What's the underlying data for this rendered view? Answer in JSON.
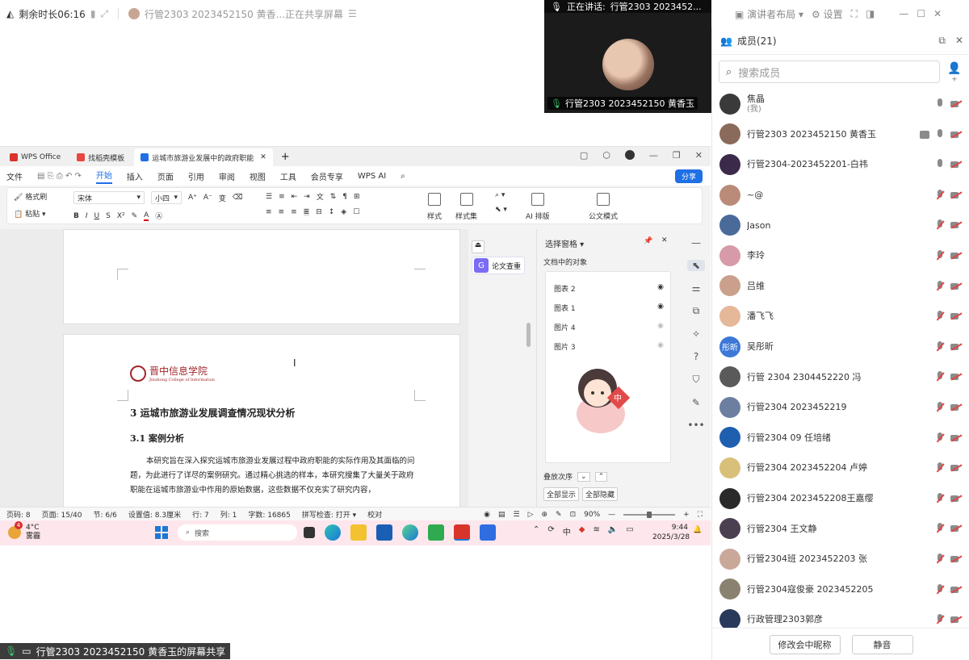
{
  "topbar": {
    "remaining_time": "剩余时长06:16",
    "sharing_status": "行管2303 2023452150 黄香...正在共享屏幕",
    "layout_label": "演讲者布局",
    "settings_label": "设置"
  },
  "speaker": {
    "speaking_label": "正在讲话:",
    "speaking_name": "行管2303 2023452...",
    "tile_name": "行管2303 2023452150 黄香玉"
  },
  "wps": {
    "tabs": [
      {
        "label": "WPS Office",
        "color": "#d9342b"
      },
      {
        "label": "找稻壳模板",
        "color": "#e8473d"
      },
      {
        "label": "运城市旅游业发展中的政府职能",
        "color": "#1f6fe5"
      }
    ],
    "menu": [
      "文件",
      "开始",
      "插入",
      "页面",
      "引用",
      "审阅",
      "视图",
      "工具",
      "会员专享",
      "WPS AI"
    ],
    "active_menu": "开始",
    "share_label": "分享",
    "ribbon": {
      "format_painter": "格式刷",
      "paste": "粘贴",
      "font": "宋体",
      "size": "小四",
      "styles": "样式",
      "style_set": "样式集",
      "ai_layout": "AI 排版",
      "official_mode": "公文模式"
    },
    "document": {
      "logo_text": "晋中信息学院",
      "logo_sub": "Jinzhong College of Information",
      "heading3": "3 运城市旅游业发展调查情况现状分析",
      "heading31": "3.1  案例分析",
      "paragraph": "本研究旨在深入探究运城市旅游业发展过程中政府职能的实际作用及其面临的问题，为此进行了详尽的案例研究。通过精心挑选的样本，本研究搜集了大量关于政府职能在运城市旅游业中作用的原始数据，这些数据不仅充实了研究内容，"
    },
    "paper_check": "论文查重",
    "selection_pane": {
      "title": "选择窗格",
      "subtitle": "文档中的对象",
      "items": [
        "图表 2",
        "图表 1",
        "图片 4",
        "图片 3"
      ],
      "order_label": "叠放次序",
      "show_all": "全部显示",
      "hide_all": "全部隐藏"
    },
    "status": {
      "page_code": "页码: 8",
      "page": "页面: 15/40",
      "section": "节: 6/6",
      "position": "设置值: 8.3厘米",
      "row": "行: 7",
      "col": "列: 1",
      "words": "字数: 16865",
      "spell": "拼写检查: 打开",
      "proof": "校对",
      "zoom": "90%",
      "zoom_level": 0.5
    }
  },
  "taskbar": {
    "temp": "4°C",
    "weather": "雾霾",
    "badge": "4",
    "search": "搜索",
    "time": "9:44",
    "date": "2025/3/28"
  },
  "share_label": "行管2303 2023452150 黄香玉的屏幕共享",
  "members": {
    "title": "成员(21)",
    "search_placeholder": "搜索成员",
    "list": [
      {
        "name": "焦晶",
        "me": "(我)",
        "mic": "on",
        "color": "#3a3a3a",
        "avatar_text": ""
      },
      {
        "name": "行管2303 2023452150 黄香玉",
        "mic": "on",
        "screen": true,
        "color": "#8a6a5a",
        "avatar_text": ""
      },
      {
        "name": "行管2304-2023452201-白祎",
        "mic": "on",
        "color": "#3b2a4a",
        "avatar_text": ""
      },
      {
        "name": "~@",
        "mic": "off",
        "color": "#b98b78",
        "avatar_text": ""
      },
      {
        "name": "Jason",
        "mic": "off",
        "color": "#4a6a9a",
        "avatar_text": ""
      },
      {
        "name": "李玲",
        "mic": "off",
        "color": "#d79aa8",
        "avatar_text": ""
      },
      {
        "name": "吕维",
        "mic": "off",
        "color": "#caa08c",
        "avatar_text": ""
      },
      {
        "name": "潘飞飞",
        "mic": "off",
        "color": "#e6b89a",
        "avatar_text": ""
      },
      {
        "name": "吴彤昕",
        "mic": "off",
        "color": "#3d78d8",
        "avatar_text": "彤昕"
      },
      {
        "name": "行管 2304 2304452220 冯",
        "mic": "off",
        "color": "#5a5a5a",
        "avatar_text": ""
      },
      {
        "name": "行管2304  2023452219",
        "mic": "off",
        "color": "#6c7fa0",
        "avatar_text": ""
      },
      {
        "name": "行管2304 09 任培绪",
        "mic": "off",
        "color": "#1e5fb0",
        "avatar_text": ""
      },
      {
        "name": "行管2304 2023452204 卢婷",
        "mic": "off",
        "color": "#d9c07a",
        "avatar_text": ""
      },
      {
        "name": "行管2304 2023452208王嘉缨",
        "mic": "off",
        "color": "#2a2a2a",
        "avatar_text": ""
      },
      {
        "name": "行管2304 王文静",
        "mic": "off",
        "color": "#4a4050",
        "avatar_text": ""
      },
      {
        "name": "行管2304班 2023452203 张",
        "mic": "off",
        "color": "#c9a89a",
        "avatar_text": ""
      },
      {
        "name": "行管2304寇俊豪 2023452205",
        "mic": "off",
        "color": "#8a8270",
        "avatar_text": ""
      },
      {
        "name": "行政管理2303郭彦",
        "mic": "off",
        "color": "#2a3a5a",
        "avatar_text": ""
      }
    ],
    "rename_button": "修改会中昵称",
    "mute_button": "静音"
  }
}
